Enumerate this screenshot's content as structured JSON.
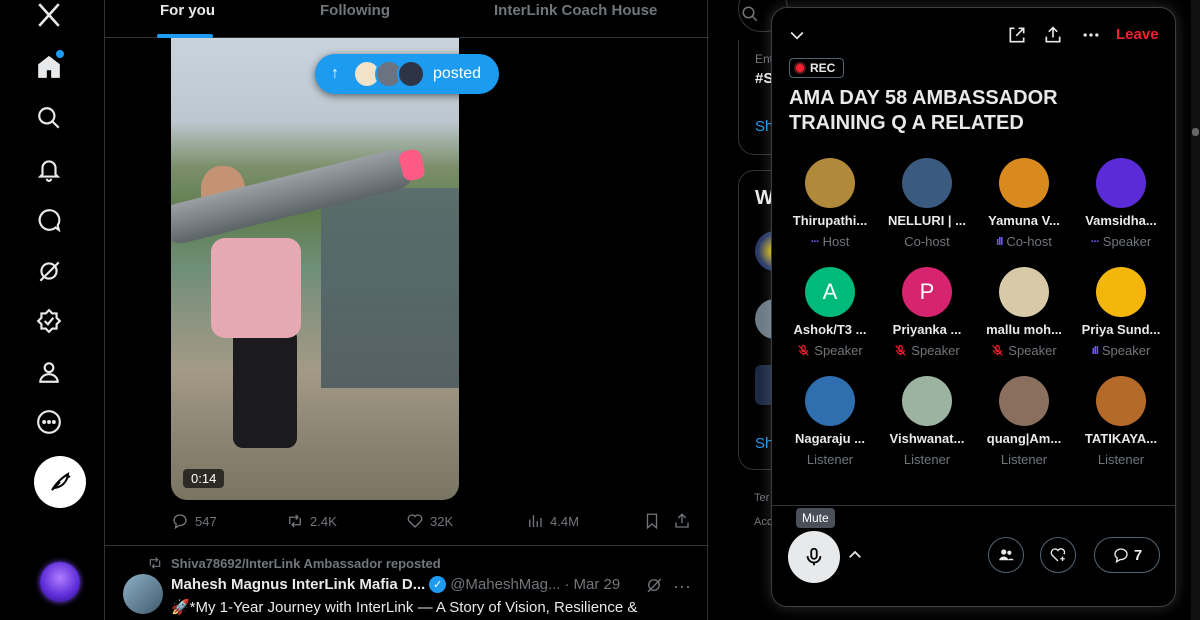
{
  "nav": {
    "items": [
      "x-logo-icon",
      "home-icon",
      "search-icon",
      "bell-icon",
      "messages-icon",
      "grok-icon",
      "verified-icon",
      "profile-icon",
      "more-icon"
    ]
  },
  "timeline": {
    "tabs": [
      {
        "label": "For you",
        "active": true
      },
      {
        "label": "Following",
        "active": false
      },
      {
        "label": "InterLink Coach House",
        "active": false
      }
    ],
    "posted_pill": {
      "label": "posted"
    },
    "video_time": "0:14",
    "actions": {
      "replies": "547",
      "reposts": "2.4K",
      "likes": "32K",
      "views": "4.4M"
    },
    "next_post": {
      "repost_by": "Shiva78692/InterLink Ambassador reposted",
      "author_name": "Mahesh Magnus InterLink Mafia D...",
      "handle": "@MaheshMag...",
      "sep": "·",
      "date": "Mar 29",
      "text": "🚀*My 1-Year Journey with InterLink — A Story of Vision, Resilience &"
    }
  },
  "sidebar": {
    "search_placeholder": "Search",
    "trend_meta": "Ent",
    "trend_tag": "#S",
    "show_more_1": "Sh",
    "who_title": "W",
    "show_more_2": "Sh",
    "footer1": "Ter",
    "footer2": "Acc"
  },
  "space": {
    "leave_label": "Leave",
    "rec_label": "REC",
    "title": "AMA DAY 58 AMBASSADOR TRAINING Q A RELATED",
    "participants": [
      {
        "name": "Thirupathi...",
        "role": "Host",
        "role_icon": "host",
        "avatar": "#b08a3a"
      },
      {
        "name": "NELLURI | ...",
        "role": "Co-host",
        "role_icon": "none",
        "avatar": "#3b5a80"
      },
      {
        "name": "Yamuna V...",
        "role": "Co-host",
        "role_icon": "speaking",
        "avatar": "#d98a1f"
      },
      {
        "name": "Vamsidha...",
        "role": "Speaker",
        "role_icon": "host",
        "avatar": "#5b2bd8"
      },
      {
        "name": "Ashok/T3 ...",
        "role": "Speaker",
        "role_icon": "muted",
        "avatar": "#00ba7c",
        "initial": "A"
      },
      {
        "name": "Priyanka ...",
        "role": "Speaker",
        "role_icon": "muted",
        "avatar": "#d6246e",
        "initial": "P"
      },
      {
        "name": "mallu moh...",
        "role": "Speaker",
        "role_icon": "muted",
        "avatar": "#d8c9a8"
      },
      {
        "name": "Priya Sund...",
        "role": "Speaker",
        "role_icon": "speaking",
        "avatar": "#f2b70a"
      },
      {
        "name": "Nagaraju ...",
        "role": "Listener",
        "role_icon": "none",
        "avatar": "#2f6fb0"
      },
      {
        "name": "Vishwanat...",
        "role": "Listener",
        "role_icon": "none",
        "avatar": "#9bb3a0"
      },
      {
        "name": "quang|Am...",
        "role": "Listener",
        "role_icon": "none",
        "avatar": "#8a6f5e"
      },
      {
        "name": "TATIKAYA...",
        "role": "Listener",
        "role_icon": "none",
        "avatar": "#b56a2a"
      }
    ],
    "mute_tooltip": "Mute",
    "comments_count": "7"
  },
  "colors": {
    "accent": "#1d9bf0",
    "leave": "#f4212e",
    "speaking": "#7856ff",
    "background": "#000000",
    "border": "#2f3336"
  }
}
